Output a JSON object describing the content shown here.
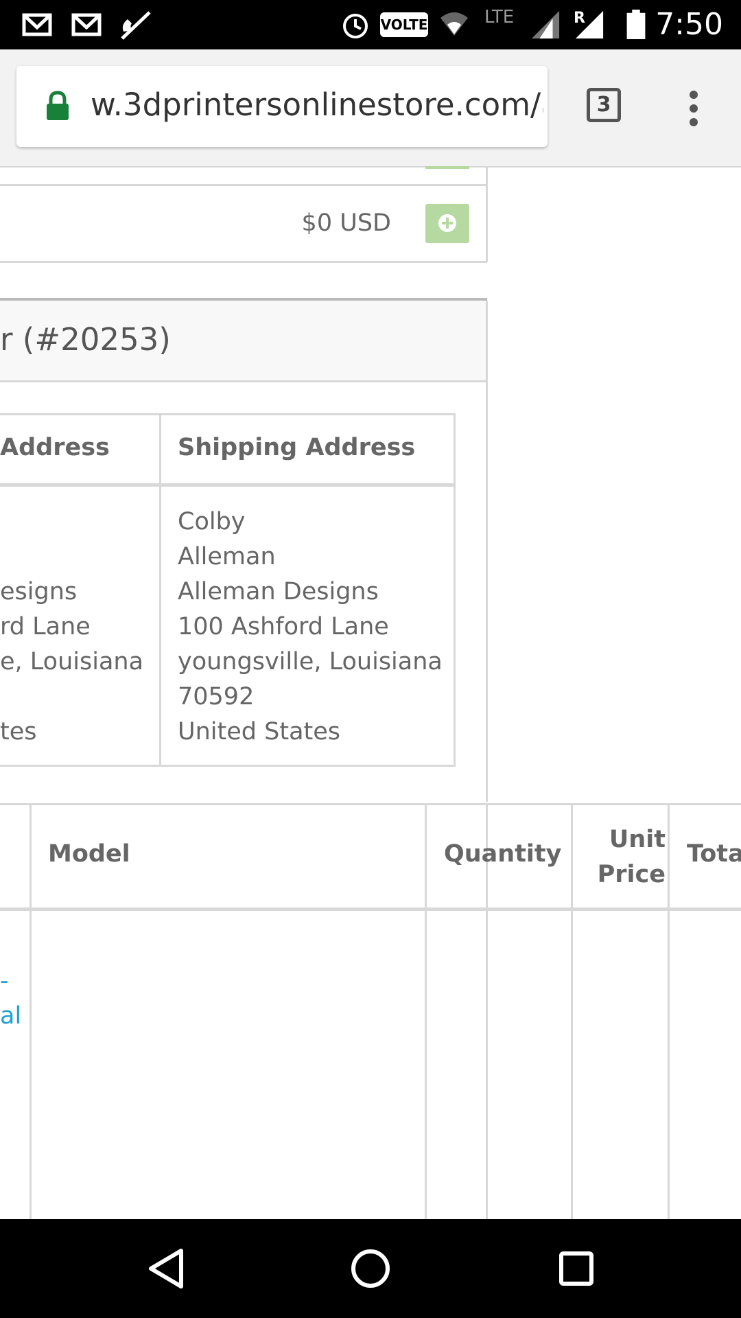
{
  "status_bar": {
    "time": "7:50",
    "icons": [
      "gmail-icon",
      "gmail-icon",
      "phone-muted-icon",
      "alarm-icon",
      "volte-badge",
      "wifi-icon",
      "lte-signal-icon",
      "roaming-signal-icon",
      "battery-icon"
    ],
    "volte_label": "VOLTE",
    "lte_label": "LTE",
    "roaming_label": "R"
  },
  "browser": {
    "url_main": "w.3dprintersonlinestore.com/",
    "url_fade": "a",
    "tab_count": "3"
  },
  "order": {
    "price_line": "$0 USD",
    "title": "r (#20253)",
    "payment_header": "Address",
    "shipping_header": "Shipping Address",
    "payment_lines": [
      "",
      "",
      "esigns",
      "rd Lane",
      "e, Louisiana",
      "",
      "tes"
    ],
    "shipping_lines": [
      "Colby",
      "Alleman",
      "Alleman Designs",
      "100 Ashford Lane",
      "youngsville, Louisiana",
      "70592",
      "United States"
    ]
  },
  "products_table": {
    "headers": [
      "Model",
      "Quantity",
      "Unit Price",
      "Tota"
    ],
    "unit_price_line1": "Unit",
    "unit_price_line2": "Price",
    "link_fragment_1": "-",
    "link_fragment_2": "al"
  },
  "colors": {
    "accent_green": "#b5d9a1",
    "link_blue": "#23a1d1",
    "lock_green": "#188038"
  }
}
